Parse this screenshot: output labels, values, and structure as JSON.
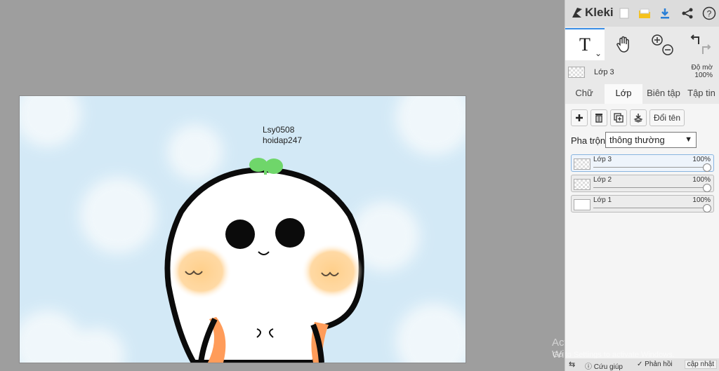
{
  "app": {
    "name": "Kleki"
  },
  "canvas": {
    "text_line1": "Lsy0508",
    "text_line2": "hoidap247"
  },
  "tools": {
    "text_tool": "T",
    "text_tool_arrow": "⌄"
  },
  "layer_status": {
    "layer_name": "Lớp 3",
    "opacity_label": "Độ mờ",
    "opacity_value": "100%"
  },
  "tabs": [
    {
      "label": "Chữ"
    },
    {
      "label": "Lớp"
    },
    {
      "label": "Biên tập"
    },
    {
      "label": "Tập tin"
    }
  ],
  "layer_panel": {
    "rename_label": "Đổi tên",
    "blend_label": "Pha trộn",
    "blend_value": "thông thường",
    "layers": [
      {
        "name": "Lớp 3",
        "opacity": "100%"
      },
      {
        "name": "Lớp 2",
        "opacity": "100%"
      },
      {
        "name": "Lớp 1",
        "opacity": "100%"
      }
    ]
  },
  "watermark": {
    "title": "Activate Windows",
    "subtitle": "Go to Settings to activate Windows."
  },
  "footer": {
    "help": "Cứu giúp",
    "feedback": "Phản hồi",
    "update": "cập nhật"
  },
  "colors": {
    "accent": "#3a8ee6",
    "sky": "#d3e9f6",
    "sprout": "#6fd66a",
    "blush": "#ffcf8a"
  }
}
